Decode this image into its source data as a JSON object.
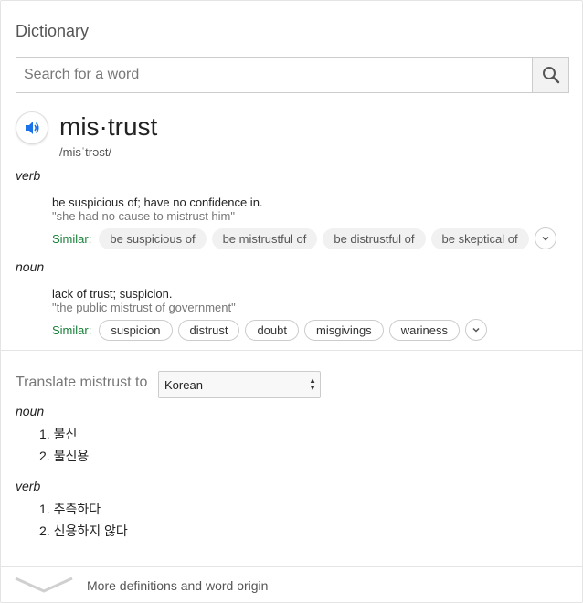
{
  "header": {
    "title": "Dictionary"
  },
  "search": {
    "placeholder": "Search for a word"
  },
  "entry": {
    "word": "mis·trust",
    "phonetic": "/misˈtrəst/",
    "verb": {
      "pos": "verb",
      "definition": "be suspicious of; have no confidence in.",
      "example": "\"she had no cause to mistrust him\"",
      "similar_label": "Similar:",
      "similar": [
        "be suspicious of",
        "be mistrustful of",
        "be distrustful of",
        "be skeptical of"
      ]
    },
    "noun": {
      "pos": "noun",
      "definition": "lack of trust; suspicion.",
      "example": "\"the public mistrust of government\"",
      "similar_label": "Similar:",
      "similar": [
        "suspicion",
        "distrust",
        "doubt",
        "misgivings",
        "wariness"
      ]
    }
  },
  "translate": {
    "label": "Translate mistrust to",
    "language": "Korean",
    "noun": {
      "pos": "noun",
      "items": [
        "1. 불신",
        "2. 불신용"
      ]
    },
    "verb": {
      "pos": "verb",
      "items": [
        "1. 추측하다",
        "2. 신용하지 않다"
      ]
    }
  },
  "footer": {
    "more_label": "More definitions and word origin"
  },
  "colors": {
    "accent_blue": "#1a73e8",
    "similar_green": "#188038"
  },
  "icons": {
    "search": "search-icon",
    "audio": "speaker-icon",
    "expand": "chevron-down-icon"
  }
}
